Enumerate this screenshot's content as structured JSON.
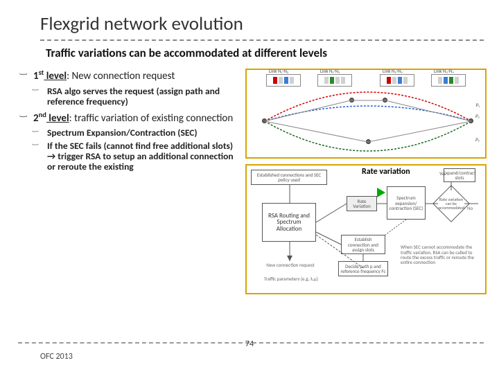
{
  "title": "Flexgrid network evolution",
  "subtitle": "Traffic variations can be accommodated at different levels",
  "bullets": {
    "l1": {
      "heading_a": "1",
      "heading_sup": "st",
      "heading_b": " level",
      "heading_rest": ": New connection request",
      "sub": [
        "RSA algo serves the request (assign path and reference frequency)"
      ]
    },
    "l2": {
      "heading_a": "2",
      "heading_sup": "nd",
      "heading_b": " level",
      "heading_rest": ": traffic variation of existing connection",
      "sub": [
        "Spectrum Expansion/Contraction (SEC)",
        "If the SEC fails (cannot find free additional slots) → trigger RSA to setup an additional connection or reroute the existing"
      ]
    }
  },
  "top_labels": {
    "link1": "Link N₁-N₂",
    "link2": "Link N₁-N₃",
    "link3": "Link N₂-N₃",
    "link4": "Link N₃-N₄",
    "p1": "P₁",
    "p2": "P₂",
    "p3": "P₃"
  },
  "flow": {
    "established": "Established connections and SEC policy used",
    "rsa": "RSA Routing and Spectrum Allocation",
    "new_req": "New connection request",
    "traffic": "Traffic parameters (e.g. λ,μ)",
    "rate": "Rate Variation",
    "sec_box": "Spectrum expansion/ contraction (SEC)",
    "decide": "Decide path p and reference frequency Fc",
    "diamond_txt": "Rate variation can be accommodated",
    "expand": "Expand/contract slots",
    "when_sec": "When SEC cannot accommodate the traffic variation, RSA can be called to route the excess traffic or reroute the entire connection",
    "establish": "Establish connection and assign slots",
    "yes": "Yes",
    "no": "No"
  },
  "annotation": "Rate variation",
  "page": "74",
  "footer": "OFC 2013"
}
